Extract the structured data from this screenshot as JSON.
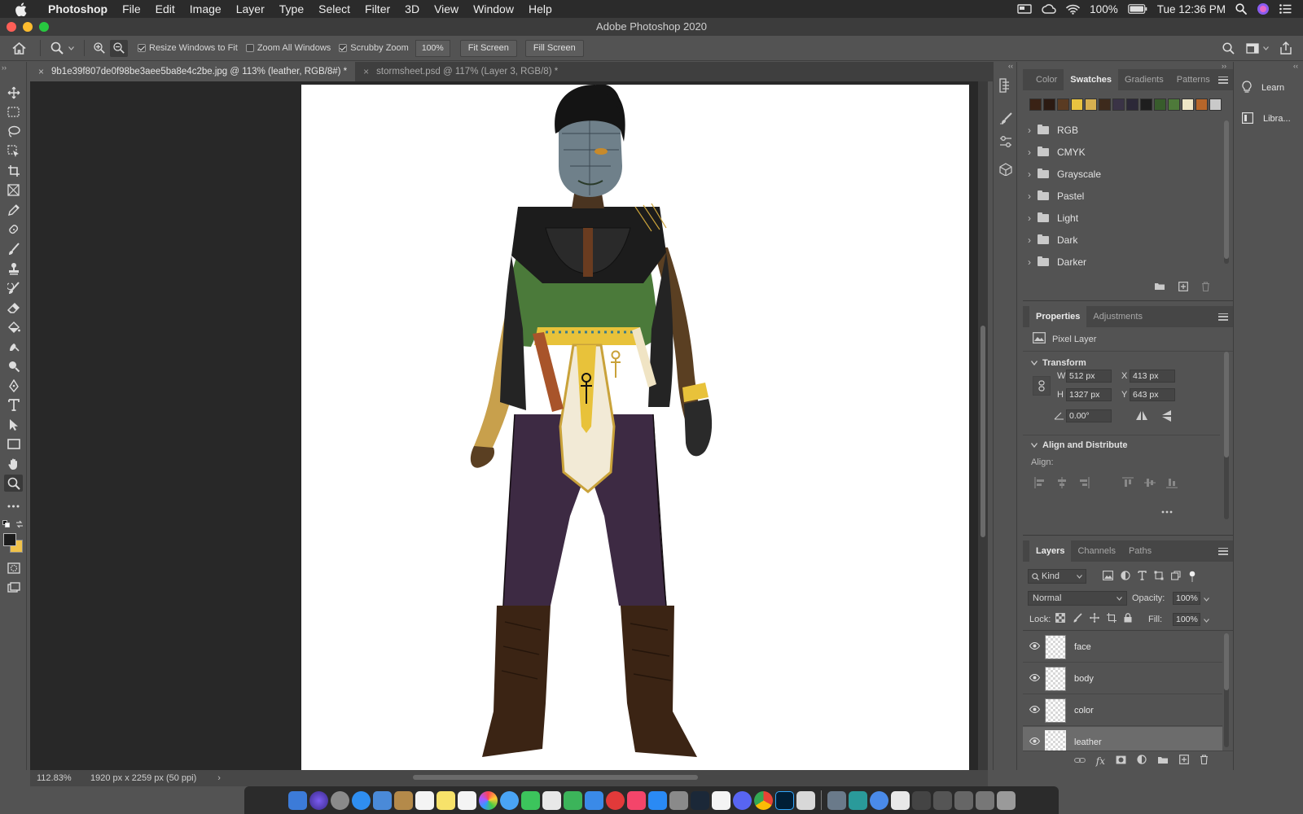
{
  "menubar": {
    "app": "Photoshop",
    "items": [
      "File",
      "Edit",
      "Image",
      "Layer",
      "Type",
      "Select",
      "Filter",
      "3D",
      "View",
      "Window",
      "Help"
    ],
    "battery": "100%",
    "clock": "Tue 12:36 PM"
  },
  "window": {
    "title": "Adobe Photoshop 2020"
  },
  "options": {
    "resize_windows_label": "Resize Windows to Fit",
    "resize_windows_checked": true,
    "zoom_all_label": "Zoom All Windows",
    "zoom_all_checked": false,
    "scrubby_label": "Scrubby Zoom",
    "scrubby_checked": true,
    "zoom_value": "100%",
    "fit_screen": "Fit Screen",
    "fill_screen": "Fill Screen"
  },
  "tabs": [
    {
      "label": "9b1e39f807de0f98be3aee5ba8e4c2be.jpg @ 113% (leather, RGB/8#) *",
      "active": true
    },
    {
      "label": "stormsheet.psd @ 117% (Layer 3, RGB/8) *",
      "active": false
    }
  ],
  "status": {
    "zoom": "112.83%",
    "doc_info": "1920 px x 2259 px (50 ppi)"
  },
  "swatches_panel": {
    "tabs": [
      "Color",
      "Swatches",
      "Gradients",
      "Patterns"
    ],
    "active_tab": "Swatches",
    "colors": [
      "#3a2215",
      "#2b1a12",
      "#5a3b22",
      "#e8c340",
      "#d6b050",
      "#3d2a1c",
      "#3a3346",
      "#2c2838",
      "#1e1e1e",
      "#385c2c",
      "#4e7a3a",
      "#efe6c6",
      "#b6662a",
      "#c9c9c9"
    ],
    "groups": [
      "RGB",
      "CMYK",
      "Grayscale",
      "Pastel",
      "Light",
      "Dark",
      "Darker"
    ]
  },
  "properties_panel": {
    "tabs": [
      "Properties",
      "Adjustments"
    ],
    "active_tab": "Properties",
    "layer_type": "Pixel Layer",
    "transform_title": "Transform",
    "w_label": "W",
    "w": "512 px",
    "h_label": "H",
    "h": "1327 px",
    "x_label": "X",
    "x": "413 px",
    "y_label": "Y",
    "y": "643 px",
    "angle": "0.00°",
    "align_title": "Align and Distribute",
    "align_label": "Align:"
  },
  "layers_panel": {
    "tabs": [
      "Layers",
      "Channels",
      "Paths"
    ],
    "active_tab": "Layers",
    "filter_kind": "Kind",
    "blend_mode": "Normal",
    "opacity_label": "Opacity:",
    "opacity": "100%",
    "lock_label": "Lock:",
    "fill_label": "Fill:",
    "fill": "100%",
    "layers": [
      {
        "name": "face",
        "selected": false
      },
      {
        "name": "body",
        "selected": false
      },
      {
        "name": "color",
        "selected": false
      },
      {
        "name": "leather",
        "selected": true
      }
    ]
  },
  "right_strip": {
    "learn": "Learn",
    "libraries": "Libra..."
  },
  "colors": {
    "foreground": "#1c1c1c",
    "background": "#f0c24a",
    "selection": "#6c6c6c"
  }
}
